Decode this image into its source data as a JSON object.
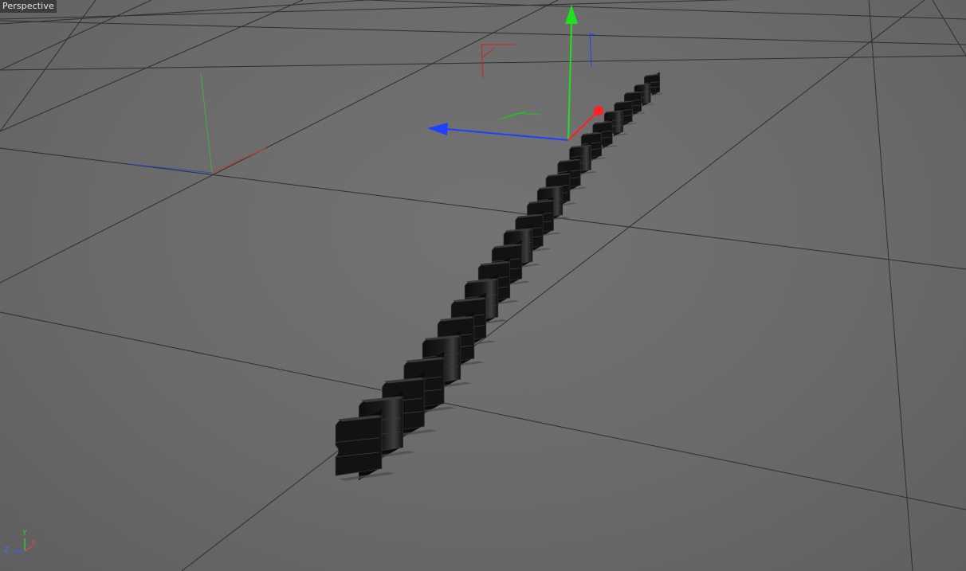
{
  "viewport": {
    "view_name": "Perspective"
  },
  "axis_indicator": {
    "x_label": "X",
    "y_label": "Y",
    "z_label": "Z",
    "x_color": "#e04040",
    "y_color": "#40c040",
    "z_color": "#4060e0"
  },
  "scene": {
    "grid_color": "#2e2e2e",
    "object_color": "#111111",
    "object_highlight": "#4a4a4a",
    "selected_object": "extruded-text",
    "tool": "move"
  },
  "gizmo": {
    "x_color": "#ff2020",
    "y_color": "#20e020",
    "z_color": "#2040ff"
  }
}
